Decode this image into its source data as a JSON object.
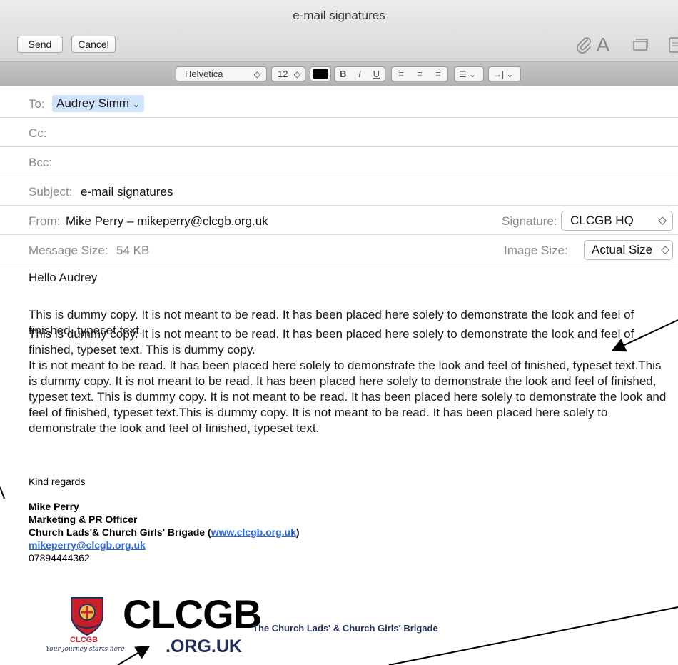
{
  "window": {
    "title": "e-mail signatures"
  },
  "toolbar": {
    "send_label": "Send",
    "cancel_label": "Cancel",
    "icons": [
      "paperclip-icon",
      "fonts-icon",
      "photo-browser-icon",
      "stationery-icon"
    ],
    "fonts_glyph": "A"
  },
  "format_bar": {
    "font": "Helvetica",
    "size": "12",
    "text_color": "#000000",
    "bold": "B",
    "italic": "I",
    "underline": "U"
  },
  "header": {
    "to_label": "To:",
    "to_value": "Audrey Simm",
    "cc_label": "Cc:",
    "bcc_label": "Bcc:",
    "subject_label": "Subject:",
    "subject_value": "e-mail signatures",
    "from_label": "From:",
    "from_value": "Mike Perry – mikeperry@clcgb.org.uk",
    "signature_label": "Signature:",
    "signature_value": "CLCGB HQ",
    "message_size_label": "Message Size:",
    "message_size_value": "54 KB",
    "image_size_label": "Image Size:",
    "image_size_value": "Actual Size"
  },
  "body": {
    "greeting": "Hello Audrey",
    "para1": "This is dummy copy. It is not meant to be read. It has been placed here solely to demonstrate the look and feel of finished, typeset text.",
    "para2_line1": "This is dummy copy. It is not meant to be read. It has been placed here solely to demonstrate the look and feel of finished, typeset text. This is dummy copy.",
    "para2_rest": "It is not meant to be read. It has been placed here solely to demonstrate the look and feel of finished, typeset text.This is dummy copy. It is not meant to be read. It has been placed here solely to demonstrate the look and feel of finished, typeset text. This is dummy copy. It is not meant to be read. It has been placed here solely to demonstrate the look and feel of finished, typeset text.This is dummy copy. It is not meant to be read. It has been placed here solely to demonstrate the look and feel of finished, typeset text."
  },
  "signature": {
    "closing": "Kind regards",
    "name": "Mike Perry",
    "role": "Marketing & PR Officer",
    "org_prefix": "Church Lads'& Church Girls' Brigade (",
    "org_link": "www.clcgb.org.uk",
    "org_suffix": ")",
    "email": "mikeperry@clcgb.org.uk",
    "phone": "07894444362"
  },
  "logo": {
    "badge_text": "CLCGB",
    "tagline": "Your journey starts here",
    "wordmark": "CLCGB",
    "wordmark_domain": ".ORG.UK",
    "full_name": "The Church Lads' & Church Girls' Brigade"
  },
  "colors": {
    "link": "#2a6ad9",
    "token_bg": "#cfe3fb",
    "logo_red": "#c8202a",
    "logo_navy": "#23305a"
  }
}
